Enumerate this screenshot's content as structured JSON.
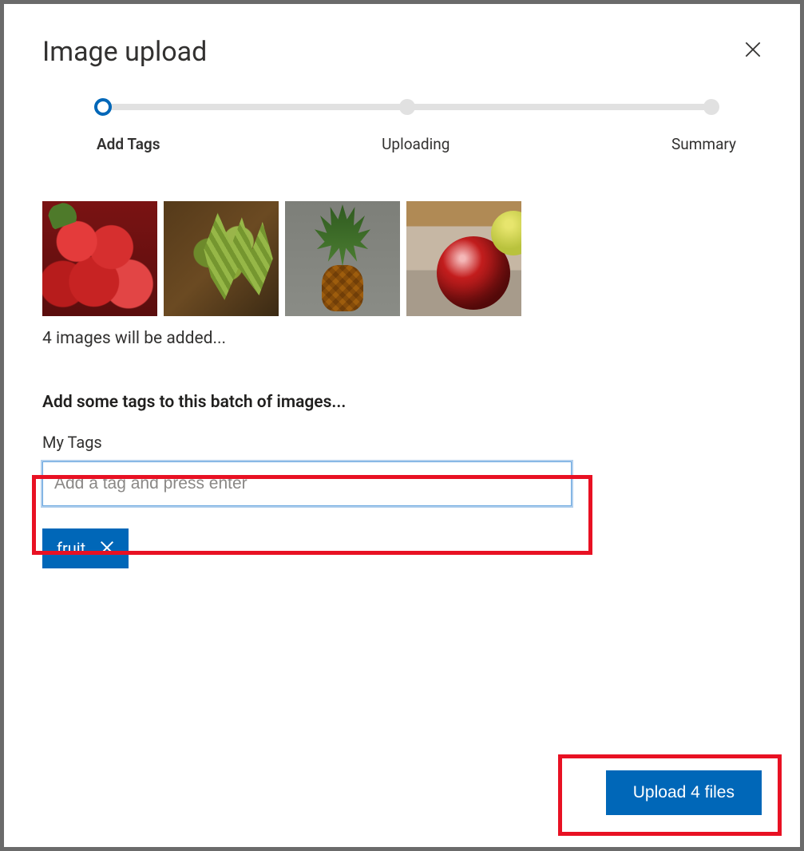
{
  "dialog": {
    "title": "Image upload"
  },
  "stepper": {
    "steps": [
      {
        "label": "Add Tags",
        "state": "active"
      },
      {
        "label": "Uploading",
        "state": "pending"
      },
      {
        "label": "Summary",
        "state": "pending"
      }
    ]
  },
  "thumbnails": [
    {
      "name": "strawberries"
    },
    {
      "name": "pineapple-top"
    },
    {
      "name": "pineapple-whole"
    },
    {
      "name": "apple"
    }
  ],
  "pending_text": "4 images will be added...",
  "tags_section": {
    "heading": "Add some tags to this batch of images...",
    "subheading": "My Tags",
    "input_placeholder": "Add a tag and press enter",
    "input_value": ""
  },
  "tags": [
    {
      "label": "fruit"
    }
  ],
  "upload_button": {
    "label": "Upload 4 files"
  }
}
